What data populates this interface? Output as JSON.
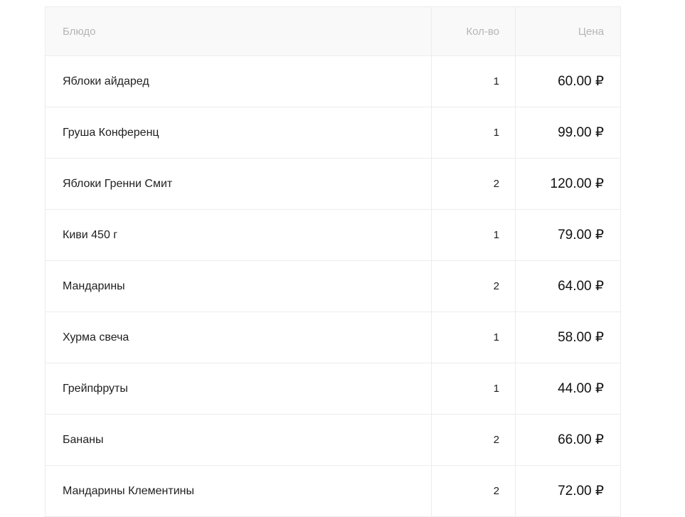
{
  "table": {
    "columns": {
      "name": "Блюдо",
      "qty": "Кол-во",
      "price": "Цена"
    },
    "rows": [
      {
        "name": "Яблоки айдаред",
        "qty": "1",
        "price": "60.00 ₽"
      },
      {
        "name": "Груша Конференц",
        "qty": "1",
        "price": "99.00 ₽"
      },
      {
        "name": "Яблоки Гренни Смит",
        "qty": "2",
        "price": "120.00 ₽"
      },
      {
        "name": "Киви 450 г",
        "qty": "1",
        "price": "79.00 ₽"
      },
      {
        "name": "Мандарины",
        "qty": "2",
        "price": "64.00 ₽"
      },
      {
        "name": "Хурма свеча",
        "qty": "1",
        "price": "58.00 ₽"
      },
      {
        "name": "Грейпфруты",
        "qty": "1",
        "price": "44.00 ₽"
      },
      {
        "name": "Бананы",
        "qty": "2",
        "price": "66.00 ₽"
      },
      {
        "name": "Мандарины Клементины",
        "qty": "2",
        "price": "72.00 ₽"
      }
    ]
  }
}
